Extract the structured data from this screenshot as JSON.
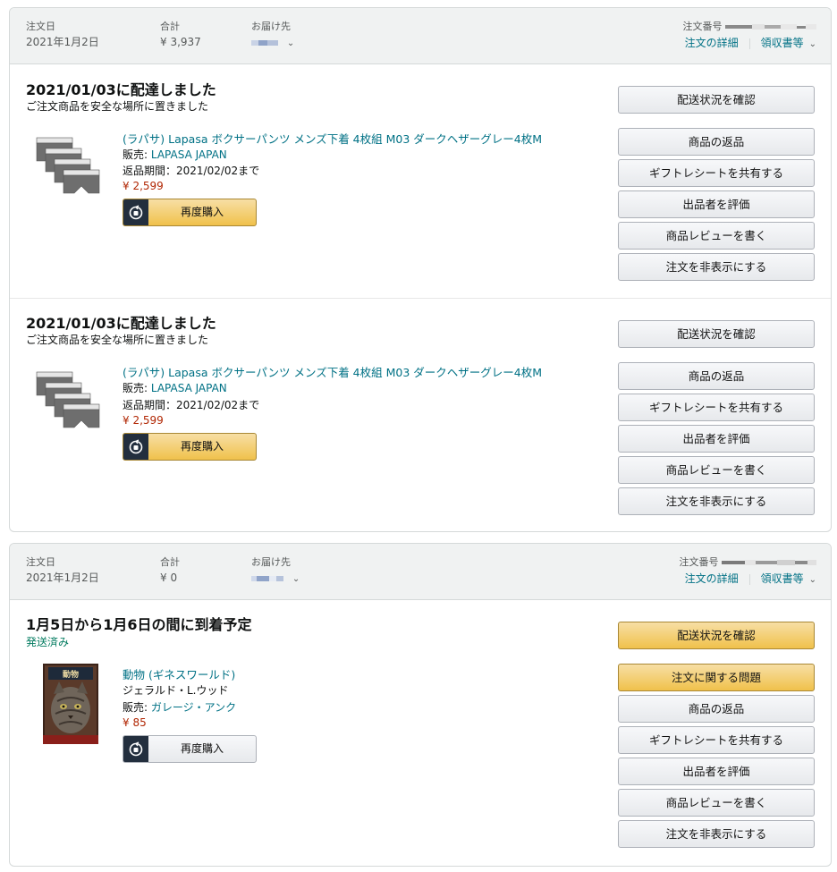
{
  "orders": [
    {
      "header": {
        "date_label": "注文日",
        "date": "2021年1月2日",
        "total_label": "合計",
        "total": "¥ 3,937",
        "ship_label": "お届け先",
        "order_no_label": "注文番号",
        "details_link": "注文の詳細",
        "receipt_link": "領収書等"
      },
      "shipments": [
        {
          "status": "2021/01/03に配達しました",
          "substatus": "ご注文商品を安全な場所に置きました",
          "item": {
            "title": "(ラパサ) Lapasa ボクサーパンツ メンズ下着 4枚組 M03 ダークヘザーグレー4枚M",
            "seller_prefix": "販売:",
            "seller": "LAPASA JAPAN",
            "return_period": "返品期間：2021/02/02まで",
            "price": "¥ 2,599",
            "buy_again": "再度購入"
          },
          "buttons": [
            "配送状況を確認",
            "商品の返品",
            "ギフトレシートを共有する",
            "出品者を評価",
            "商品レビューを書く",
            "注文を非表示にする"
          ]
        },
        {
          "status": "2021/01/03に配達しました",
          "substatus": "ご注文商品を安全な場所に置きました",
          "item": {
            "title": "(ラパサ) Lapasa ボクサーパンツ メンズ下着 4枚組 M03 ダークヘザーグレー4枚M",
            "seller_prefix": "販売:",
            "seller": "LAPASA JAPAN",
            "return_period": "返品期間：2021/02/02まで",
            "price": "¥ 2,599",
            "buy_again": "再度購入"
          },
          "buttons": [
            "配送状況を確認",
            "商品の返品",
            "ギフトレシートを共有する",
            "出品者を評価",
            "商品レビューを書く",
            "注文を非表示にする"
          ]
        }
      ]
    },
    {
      "header": {
        "date_label": "注文日",
        "date": "2021年1月2日",
        "total_label": "合計",
        "total": "¥ 0",
        "ship_label": "お届け先",
        "order_no_label": "注文番号",
        "details_link": "注文の詳細",
        "receipt_link": "領収書等"
      },
      "shipments": [
        {
          "status": "1月5日から1月6日の間に到着予定",
          "substatus": "発送済み",
          "item": {
            "title": "動物 (ギネスワールド)",
            "author": "ジェラルド・L.ウッド",
            "seller_prefix": "販売:",
            "seller": "ガレージ・アンク",
            "price": "¥ 85",
            "buy_again": "再度購入",
            "cover_text": "動物"
          },
          "buttons": [
            "配送状況を確認",
            "注文に関する問題",
            "商品の返品",
            "ギフトレシートを共有する",
            "出品者を評価",
            "商品レビューを書く",
            "注文を非表示にする"
          ]
        }
      ]
    }
  ],
  "colors": {
    "link": "#007185",
    "price": "#b12704",
    "shipped_green": "#067d62",
    "primary_button": "#f0c14b"
  }
}
